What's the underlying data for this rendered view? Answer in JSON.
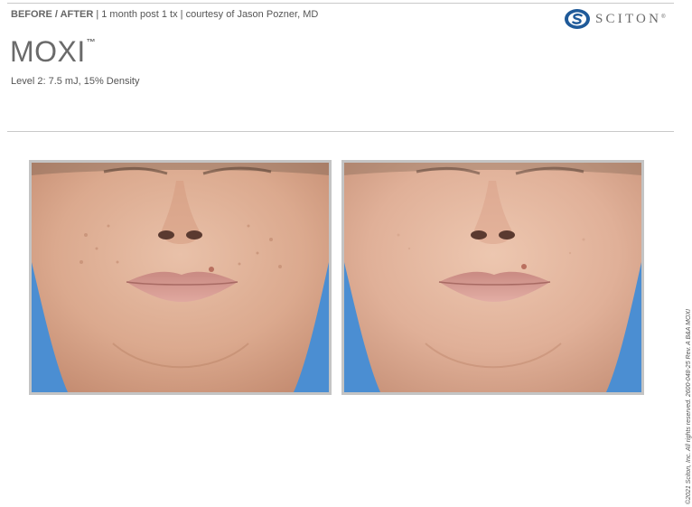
{
  "header": {
    "label_strong": "BEFORE / AFTER",
    "label_rest": " | 1 month post 1 tx | courtesy of Jason Pozner, MD"
  },
  "brand": {
    "name": "SCITON",
    "registered_mark": "®",
    "icon": "sciton-s-logo-icon",
    "color": "#1f5a99"
  },
  "treatment": {
    "title": "MOXI",
    "trademark": "™",
    "settings": "Level 2: 7.5 mJ, 15% Density"
  },
  "photos": [
    {
      "name": "before"
    },
    {
      "name": "after"
    }
  ],
  "footer": {
    "copyright": "©2021 Sciton, Inc. All rights reserved. 2600-048-25 Rev. A B&A MOXI"
  }
}
